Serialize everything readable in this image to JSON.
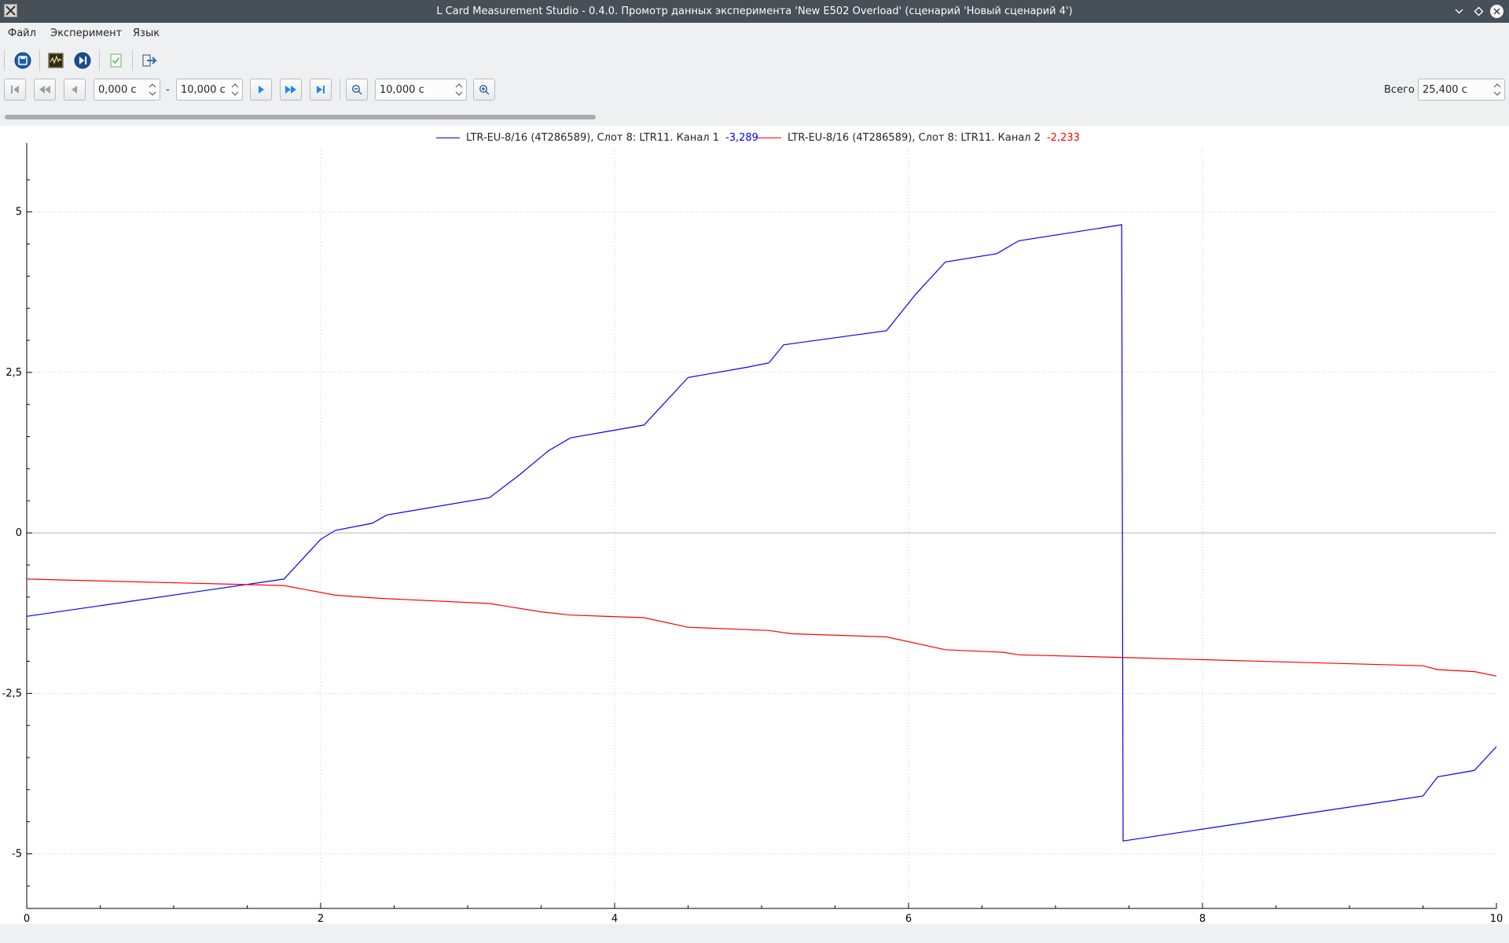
{
  "window": {
    "title": "L Card Measurement Studio - 0.4.0. Промотр данных эксперимента 'New E502 Overload' (сценарий 'Новый сценарий 4')"
  },
  "menu": {
    "items": [
      "Файл",
      "Эксперимент",
      "Язык"
    ]
  },
  "toolbar": {
    "icons": [
      "save-data-icon",
      "waveform-view-icon",
      "play-step-icon",
      "check-document-icon",
      "exit-arrow-icon"
    ]
  },
  "navigation": {
    "start_value": "0,000 с",
    "separator": "-",
    "end_value": "10,000 с",
    "window_value": "10,000 с",
    "total_label": "Всего",
    "total_value": "25,400 с",
    "scroll_position_fraction": 0.394
  },
  "colors": {
    "series1": "#0000ff",
    "series2": "#ff0000",
    "titlebar": "#475057"
  },
  "chart_data": {
    "type": "line",
    "title": "",
    "xlabel": "",
    "ylabel": "",
    "xlim": [
      0,
      10
    ],
    "ylim": [
      -5.85,
      6
    ],
    "x_ticks": [
      "0",
      "2",
      "4",
      "6",
      "8",
      "10"
    ],
    "y_ticks": [
      "5",
      "2,5",
      "0",
      "-2,5",
      "-5"
    ],
    "y_tick_values": [
      5,
      2.5,
      0,
      -2.5,
      -5
    ],
    "x_tick_values": [
      0,
      2,
      4,
      6,
      8,
      10
    ],
    "grid": true,
    "legend_position": "top-center",
    "series": [
      {
        "name": "LTR-EU-8/16 (4T286589), Слот  8: LTR11. Канал 1",
        "current_value": "-3,289",
        "color": "#0000ff",
        "x": [
          0,
          1.75,
          2.0,
          2.1,
          2.35,
          2.45,
          3.15,
          3.35,
          3.55,
          3.7,
          4.2,
          4.5,
          4.9,
          5.05,
          5.15,
          5.85,
          6.05,
          6.25,
          6.6,
          6.75,
          7.45,
          7.46,
          9.5,
          9.6,
          9.85,
          10.0
        ],
        "y": [
          -1.3,
          -0.72,
          -0.1,
          0.04,
          0.15,
          0.28,
          0.55,
          0.9,
          1.28,
          1.48,
          1.68,
          2.42,
          2.58,
          2.65,
          2.93,
          3.15,
          3.72,
          4.22,
          4.35,
          4.55,
          4.8,
          -4.8,
          -4.1,
          -3.8,
          -3.7,
          -3.33
        ]
      },
      {
        "name": "LTR-EU-8/16 (4T286589), Слот  8: LTR11. Канал 2",
        "current_value": "-2,233",
        "color": "#ff0000",
        "x": [
          0,
          1.75,
          2.1,
          2.4,
          3.15,
          3.5,
          3.7,
          4.2,
          4.5,
          5.05,
          5.2,
          5.85,
          6.25,
          6.65,
          6.75,
          7.45,
          9.5,
          9.6,
          9.85,
          10.0
        ],
        "y": [
          -0.72,
          -0.82,
          -0.97,
          -1.02,
          -1.1,
          -1.23,
          -1.28,
          -1.32,
          -1.47,
          -1.52,
          -1.57,
          -1.62,
          -1.82,
          -1.86,
          -1.9,
          -1.94,
          -2.07,
          -2.13,
          -2.16,
          -2.23
        ]
      }
    ]
  }
}
